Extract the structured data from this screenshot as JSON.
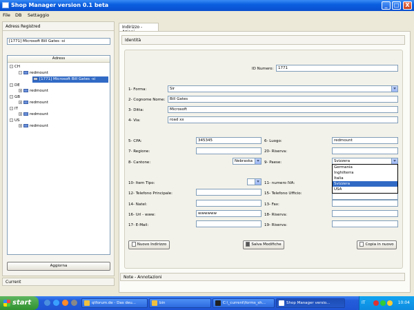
{
  "window": {
    "title": "Shop Manager version 0.1 beta",
    "controls": {
      "minimize": "_",
      "maximize": "□",
      "close": "X"
    }
  },
  "menu": [
    "File",
    "DB",
    "Settaggio"
  ],
  "left": {
    "header": "Adress Registred",
    "selected_value": "[1771] Microsoft Bill Gates -si",
    "tree_header": "Adress",
    "tree": [
      {
        "label": "CH",
        "children": [
          {
            "label": "redmount",
            "children": [
              {
                "label": "[1771] Microsoft Bill Gates -si",
                "selected": true
              }
            ]
          }
        ]
      },
      {
        "label": "DE",
        "children": [
          {
            "label": "redmount"
          }
        ]
      },
      {
        "label": "GB",
        "children": [
          {
            "label": "redmount"
          }
        ]
      },
      {
        "label": "IT",
        "children": [
          {
            "label": "redmount"
          }
        ]
      },
      {
        "label": "US",
        "children": [
          {
            "label": "redmount"
          }
        ]
      }
    ],
    "refresh_button": "Aggiorna",
    "current_label": "Current"
  },
  "right": {
    "tab": "Indirizzo - Azioni",
    "section": "Identità",
    "id_label": "ID Numero:",
    "id_value": "1771",
    "fields": {
      "forma": {
        "label": "1- Forma:",
        "value": "Sir"
      },
      "cognome": {
        "label": "2- Cognome Nome:",
        "value": "Bill Gates"
      },
      "ditta": {
        "label": "3- Ditta:",
        "value": "Microsoft"
      },
      "via": {
        "label": "4- Via:",
        "value": "road xx"
      },
      "cpa": {
        "label": "5- CPA:",
        "value": "345345"
      },
      "luogo": {
        "label": "6- Luogo:",
        "value": "redmount"
      },
      "regione": {
        "label": "7- Regione:",
        "value": ""
      },
      "riserva20": {
        "label": "20- Riserva:",
        "value": ""
      },
      "cantone": {
        "label": "8- Cantone:",
        "value": "Nebraska"
      },
      "paese": {
        "label": "9- Paese:",
        "value": "Svizzera"
      },
      "item_tipo": {
        "label": "10- Item Tipo:",
        "value": ""
      },
      "iva": {
        "label": "11- numero IVA:",
        "value": ""
      },
      "tel_principale": {
        "label": "12- Telefono Principale:",
        "value": ""
      },
      "tel_ufficio": {
        "label": "15- Telefono Ufficio:",
        "value": ""
      },
      "natel": {
        "label": "14- Natel:",
        "value": ""
      },
      "fax": {
        "label": "13- Fax:",
        "value": ""
      },
      "url": {
        "label": "16- Url - www:",
        "value": "wwwwww"
      },
      "riserva18": {
        "label": "18- Riserva:",
        "value": ""
      },
      "email": {
        "label": "17- E-Mail:",
        "value": ""
      },
      "riserva19": {
        "label": "19- Riserva:",
        "value": ""
      }
    },
    "paese_options": [
      "Germania",
      "Inghilterra",
      "Italia",
      "Svizzera",
      "USA"
    ],
    "paese_selected_index": 3,
    "buttons": {
      "nuovo": "Nuovo Indirizzo",
      "salva": "Salva Modifiche",
      "copia": "Copia in nuovo"
    },
    "notes": "Note - Annotazioni"
  },
  "taskbar": {
    "start": "start",
    "tasks": [
      "qtforum.de - Das deu...",
      "bin",
      "C:\\_current\\forms_sh...",
      "Shop Manager versio..."
    ],
    "lang": "IT",
    "clock": "10:04"
  }
}
